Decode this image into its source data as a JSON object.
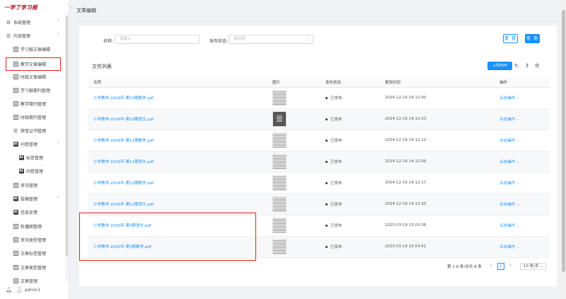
{
  "app": {
    "logo_text": "一学了学习报"
  },
  "sidebar": {
    "items": [
      {
        "label": "系统管理",
        "chevron": "˅"
      },
      {
        "label": "内容管理",
        "chevron": "˄"
      },
      {
        "label": "学习报文章编辑"
      },
      {
        "label": "教学文章编辑"
      },
      {
        "label": "时政文章编辑"
      },
      {
        "label": "学习报期刊管理"
      },
      {
        "label": "教学期刊管理"
      },
      {
        "label": "时政期刊管理"
      },
      {
        "label": "荣誉证书管理"
      },
      {
        "label": "问卷管理",
        "chevron": "˄"
      },
      {
        "label": "标签管理"
      },
      {
        "label": "问卷管理"
      },
      {
        "label": "资讯管理"
      },
      {
        "label": "投稿管理",
        "chevron": "˅"
      },
      {
        "label": "信息反馈"
      },
      {
        "label": "轮播图管理"
      },
      {
        "label": "资讯类型管理"
      },
      {
        "label": "文章标签管理"
      },
      {
        "label": "文章类型管理"
      },
      {
        "label": "文章管理"
      }
    ],
    "user": "admin1"
  },
  "header": {
    "title": "文章编辑"
  },
  "search": {
    "name_label": "名称:",
    "name_placeholder": "请输入",
    "status_label": "发布状态:",
    "status_placeholder": "请选择",
    "reset_label": "重 置",
    "query_label": "查 询"
  },
  "list": {
    "title": "文件列表",
    "upload_label": "上传PDF",
    "columns": [
      "名称",
      "图片",
      "发布状态",
      "更改时间",
      "操作"
    ],
    "rows": [
      {
        "name": "小学教学-2024年-第10期数学.pdf",
        "status": "已发布",
        "time": "2024-12-16 14:12:00",
        "action": "点击操作"
      },
      {
        "name": "小学教学-2024年-第10期语文.pdf",
        "status": "已发布",
        "time": "2024-12-16 14:12:03",
        "action": "点击操作"
      },
      {
        "name": "小学教学-2024年-第11期数学.pdf",
        "status": "已发布",
        "time": "2024-12-16 14:12:12",
        "action": "点击操作"
      },
      {
        "name": "小学教学-2024年-第11期语文.pdf",
        "status": "已发布",
        "time": "2024-12-16 14:12:06",
        "action": "点击操作"
      },
      {
        "name": "小学教学-2024年-第12期数学.pdf",
        "status": "已发布",
        "time": "2024-12-16 14:12:17",
        "action": "点击操作"
      },
      {
        "name": "小学教学-2024年-第12期语文.pdf",
        "status": "已发布",
        "time": "2024-12-16 14:12:20",
        "action": "点击操作"
      },
      {
        "name": "小学教学-2025年-第3期语文.pdf",
        "status": "已发布",
        "time": "2025-03-19 15:03:38",
        "action": "点击操作"
      },
      {
        "name": "小学教学-2025年-第3期数学.pdf",
        "status": "已发布",
        "time": "2025-03-19 15:03:41",
        "action": "点击操作"
      }
    ]
  },
  "pagination": {
    "summary": "第 1-8 条/总共 8 条",
    "prev": "<",
    "current_page": "1",
    "next": ">",
    "page_size": "10 条/页"
  },
  "colors": {
    "primary": "#1890ff",
    "highlight": "#e02020"
  }
}
